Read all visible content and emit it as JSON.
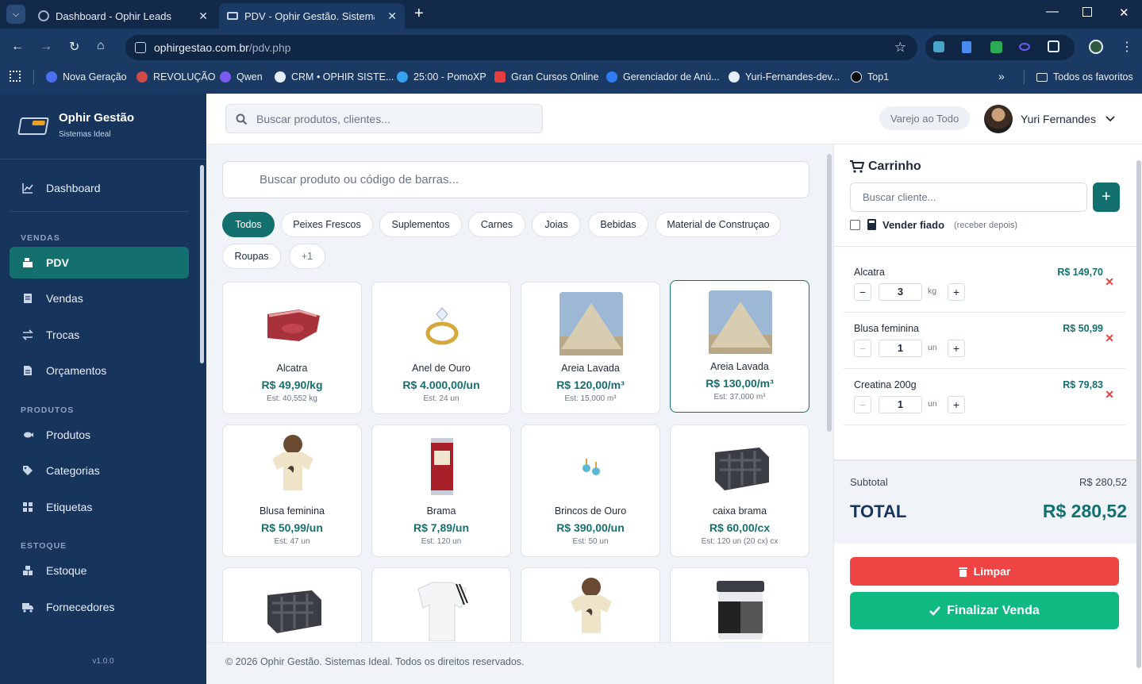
{
  "browser": {
    "tabs": [
      {
        "title": "Dashboard - Ophir Leads"
      },
      {
        "title": "PDV - Ophir Gestão. Sistemas Ideal"
      }
    ],
    "url_domain": "ophirgestao.com.br",
    "url_path": "/pdv.php",
    "bookmarks": [
      "Nova Geração",
      "REVOLUÇÃO",
      "Qwen",
      "CRM • OPHIR SISTE...",
      "25:00 - PomoXP",
      "Gran Cursos Online",
      "Gerenciador de Anú...",
      "Yuri-Fernandes-dev...",
      "Top1"
    ],
    "all_bookmarks": "Todos os favoritos"
  },
  "sidebar": {
    "brand_title": "Ophir Gestão",
    "brand_subtitle": "Sistemas Ideal",
    "dashboard": "Dashboard",
    "section_vendas": "VENDAS",
    "pdv": "PDV",
    "vendas": "Vendas",
    "trocas": "Trocas",
    "orcamentos": "Orçamentos",
    "section_produtos": "PRODUTOS",
    "produtos": "Produtos",
    "categorias": "Categorias",
    "etiquetas": "Etiquetas",
    "section_estoque": "ESTOQUE",
    "estoque": "Estoque",
    "fornecedores": "Fornecedores",
    "version": "v1.0.0"
  },
  "topbar": {
    "search_placeholder": "Buscar produtos, clientes...",
    "store": "Varejo ao Todo",
    "user": "Yuri Fernandes"
  },
  "pdv": {
    "search_placeholder": "Buscar produto ou código de barras...",
    "categories": [
      "Todos",
      "Peixes Frescos",
      "Suplementos",
      "Carnes",
      "Joias",
      "Bebidas",
      "Material de Construçao",
      "Roupas",
      "+1"
    ],
    "products": [
      {
        "name": "Alcatra",
        "price": "R$ 49,90/kg",
        "stock": "Est: 40,552 kg",
        "icon": "meat"
      },
      {
        "name": "Anel de Ouro",
        "price": "R$ 4.000,00/un",
        "stock": "Est: 24 un",
        "icon": "ring"
      },
      {
        "name": "Areia Lavada",
        "price": "R$ 120,00/m³",
        "stock": "Est: 15,000 m³",
        "icon": "sand"
      },
      {
        "name": "Areia Lavada",
        "price": "R$ 130,00/m³",
        "stock": "Est: 37,000 m³",
        "icon": "sand"
      },
      {
        "name": "Blusa feminina",
        "price": "R$ 50,99/un",
        "stock": "Est: 47 un",
        "icon": "blouse"
      },
      {
        "name": "Brama",
        "price": "R$ 7,89/un",
        "stock": "Est: 120 un",
        "icon": "can"
      },
      {
        "name": "Brincos de Ouro",
        "price": "R$ 390,00/un",
        "stock": "Est: 50 un",
        "icon": "earrings"
      },
      {
        "name": "caixa brama",
        "price": "R$ 60,00/cx",
        "stock": "Est: 120 un (20 cx) cx",
        "icon": "crate"
      }
    ],
    "footer": "© 2026 Ophir Gestão. Sistemas Ideal. Todos os direitos reservados."
  },
  "cart": {
    "title": "Carrinho",
    "client_placeholder": "Buscar cliente...",
    "fiado_label": "Vender fiado",
    "fiado_hint": "(receber depois)",
    "items": [
      {
        "name": "Alcatra",
        "qty": "3",
        "unit": "kg",
        "price": "R$ 149,70"
      },
      {
        "name": "Blusa feminina",
        "qty": "1",
        "unit": "un",
        "price": "R$ 50,99"
      },
      {
        "name": "Creatina 200g",
        "qty": "1",
        "unit": "un",
        "price": "R$ 79,83"
      }
    ],
    "subtotal_label": "Subtotal",
    "subtotal": "R$ 280,52",
    "total_label": "TOTAL",
    "total": "R$ 280,52",
    "clear_label": "Limpar",
    "finish_label": "Finalizar Venda"
  },
  "colors": {
    "primary": "#13706f",
    "sidebar": "#17345d",
    "danger": "#ef4444",
    "success": "#10b981"
  }
}
